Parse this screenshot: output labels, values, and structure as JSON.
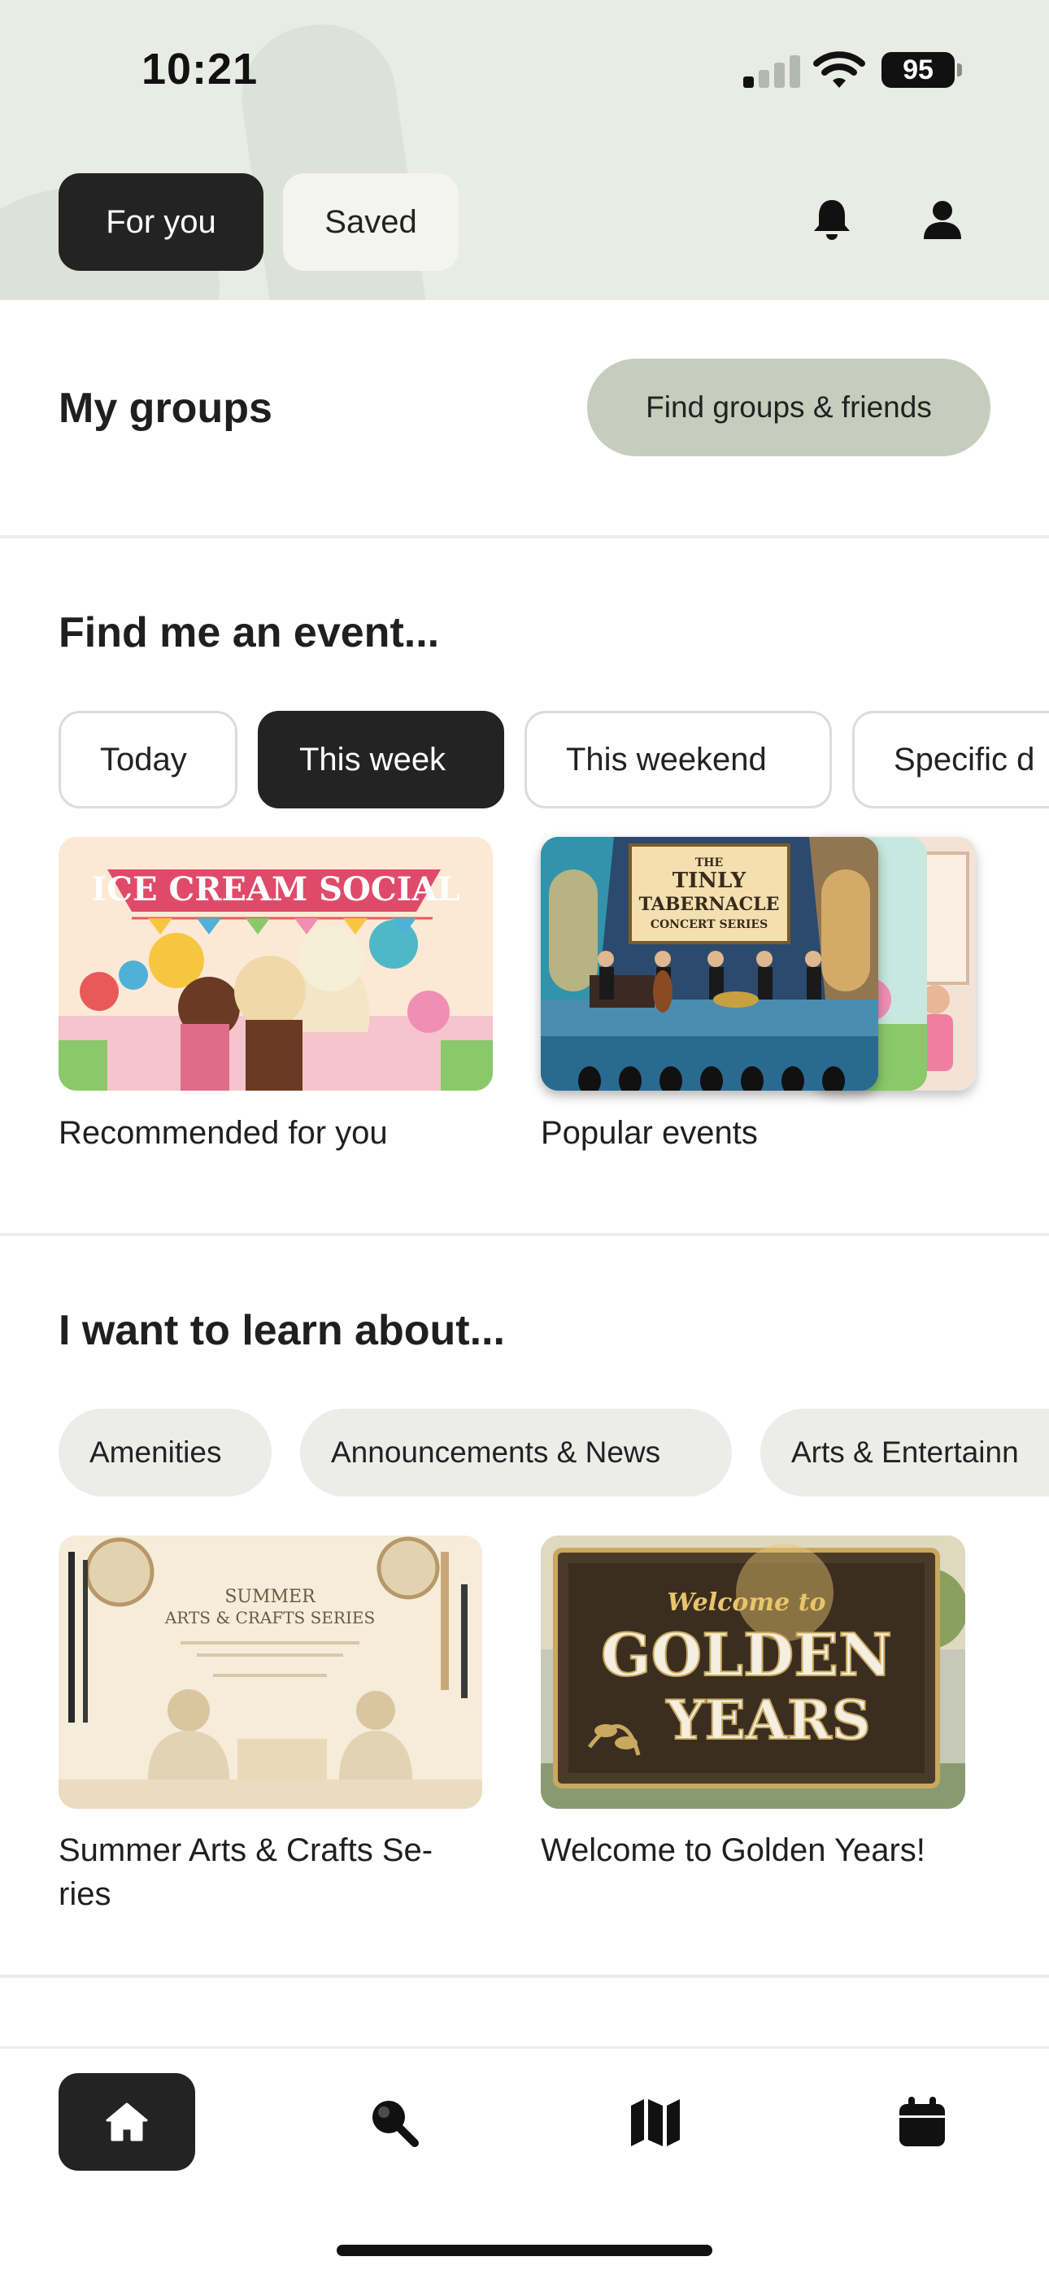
{
  "status_bar": {
    "time": "10:21",
    "battery": "95"
  },
  "header_tabs": [
    {
      "label": "For you",
      "active": true
    },
    {
      "label": "Saved",
      "active": false
    }
  ],
  "header_icons": [
    "bell-icon",
    "user-icon"
  ],
  "my_groups": {
    "title": "My groups",
    "button_label": "Find groups & friends"
  },
  "find_event": {
    "title": "Find me an event...",
    "filters": [
      {
        "label": "Today",
        "active": false
      },
      {
        "label": "This week",
        "active": true
      },
      {
        "label": "This weekend",
        "active": false
      },
      {
        "label": "Specific d",
        "active": false
      }
    ],
    "cards": [
      {
        "label": "Recommended for you",
        "image_text": "ICE CREAM SOCIAL"
      },
      {
        "label": "Popular events",
        "image_text": [
          "THE",
          "TINLY",
          "TABERNACLE",
          "CONCERT SERIES"
        ]
      }
    ]
  },
  "learn_about": {
    "title": "I want to learn about...",
    "topics": [
      "Amenities",
      "Announcements & News",
      "Arts & Entertainn"
    ],
    "cards": [
      {
        "label_line1": "Summer Arts & Crafts Se-",
        "label_line2": "ries",
        "image_text": [
          "SUMMER",
          "ARTS & CRAFTS SERIES"
        ]
      },
      {
        "label_line1": "Welcome to Golden Years!",
        "image_text": [
          "Welcome to",
          "GOLDEN",
          "YEARS"
        ]
      }
    ]
  },
  "bottom_nav": [
    {
      "name": "home-icon",
      "active": true
    },
    {
      "name": "search-icon",
      "active": false
    },
    {
      "name": "map-icon",
      "active": false
    },
    {
      "name": "calendar-icon",
      "active": false
    }
  ],
  "colors": {
    "header_bg": "#e9ebe5",
    "active_pill": "#232323",
    "find_button": "#c6cdbd",
    "topic_chip": "#ecedea"
  }
}
